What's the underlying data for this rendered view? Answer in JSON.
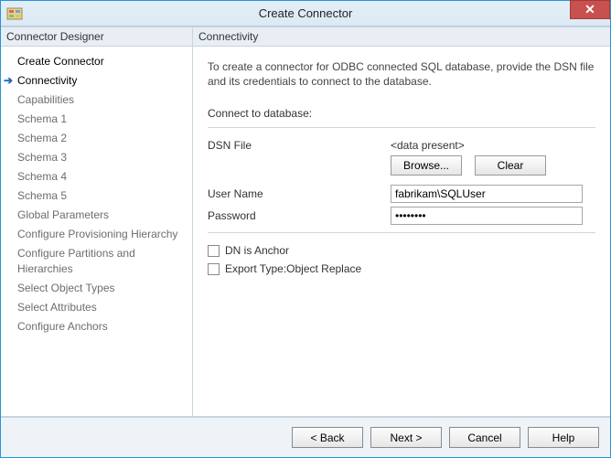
{
  "window": {
    "title": "Create Connector"
  },
  "sidebar": {
    "header": "Connector Designer",
    "items": [
      {
        "label": "Create Connector",
        "state": "done"
      },
      {
        "label": "Connectivity",
        "state": "current"
      },
      {
        "label": "Capabilities",
        "state": "pending"
      },
      {
        "label": "Schema 1",
        "state": "pending"
      },
      {
        "label": "Schema 2",
        "state": "pending"
      },
      {
        "label": "Schema 3",
        "state": "pending"
      },
      {
        "label": "Schema 4",
        "state": "pending"
      },
      {
        "label": "Schema 5",
        "state": "pending"
      },
      {
        "label": "Global Parameters",
        "state": "pending"
      },
      {
        "label": "Configure Provisioning Hierarchy",
        "state": "pending"
      },
      {
        "label": "Configure Partitions and Hierarchies",
        "state": "pending"
      },
      {
        "label": "Select Object Types",
        "state": "pending"
      },
      {
        "label": "Select Attributes",
        "state": "pending"
      },
      {
        "label": "Configure Anchors",
        "state": "pending"
      }
    ]
  },
  "main": {
    "header": "Connectivity",
    "description": "To create a connector for ODBC connected SQL database, provide the DSN file and its credentials to connect to the database.",
    "connect_label": "Connect to database:",
    "dsn_label": "DSN File",
    "dsn_value": "<data present>",
    "browse": "Browse...",
    "clear": "Clear",
    "user_label": "User Name",
    "user_value": "fabrikam\\SQLUser",
    "pwd_label": "Password",
    "pwd_value": "••••••••",
    "chk1": "DN is Anchor",
    "chk2": "Export Type:Object Replace"
  },
  "footer": {
    "back": "<  Back",
    "next": "Next  >",
    "cancel": "Cancel",
    "help": "Help"
  }
}
